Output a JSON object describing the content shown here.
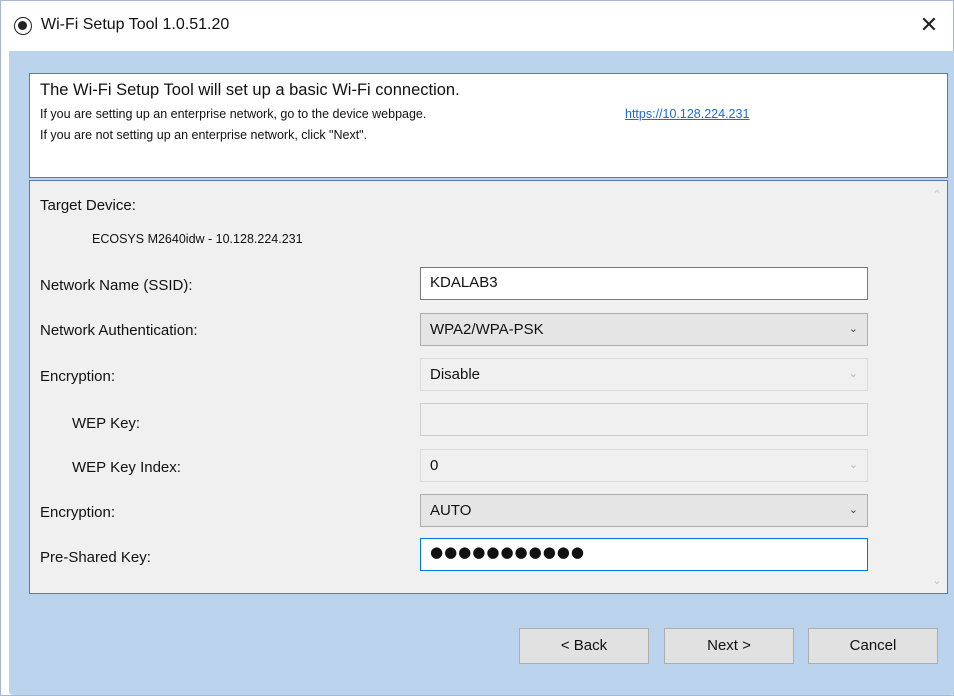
{
  "window": {
    "title": "Wi-Fi Setup Tool 1.0.51.20",
    "icon": "app-icon",
    "close_glyph": "✕"
  },
  "info": {
    "heading": "The Wi-Fi Setup Tool will set up a basic Wi-Fi connection.",
    "line1": "If you are setting up an enterprise network, go to the device webpage.",
    "link": "https://10.128.224.231",
    "line2": "If you are not setting up an enterprise network, click \"Next\"."
  },
  "form": {
    "target_label": "Target Device:",
    "target_value": "ECOSYS M2640idw - 10.128.224.231",
    "ssid_label": "Network Name (SSID):",
    "ssid_value": "KDALAB3",
    "auth_label": "Network Authentication:",
    "auth_value": "WPA2/WPA-PSK",
    "enc1_label": "Encryption:",
    "enc1_value": "Disable",
    "wep_key_label": "WEP Key:",
    "wep_key_value": "",
    "wep_index_label": "WEP Key Index:",
    "wep_index_value": "0",
    "enc2_label": "Encryption:",
    "enc2_value": "AUTO",
    "psk_label": "Pre-Shared Key:",
    "psk_value": "●●●●●●●●●●●"
  },
  "buttons": {
    "back": "< Back",
    "next": "Next >",
    "cancel": "Cancel"
  },
  "glyphs": {
    "chevron": "⌄",
    "scroll_up": "⌃",
    "scroll_down": "⌄"
  },
  "colors": {
    "accent": "#0078d7",
    "link": "#1a6bd8",
    "client_bg": "#bcd3ed",
    "panel_border": "#4f7fb0"
  }
}
